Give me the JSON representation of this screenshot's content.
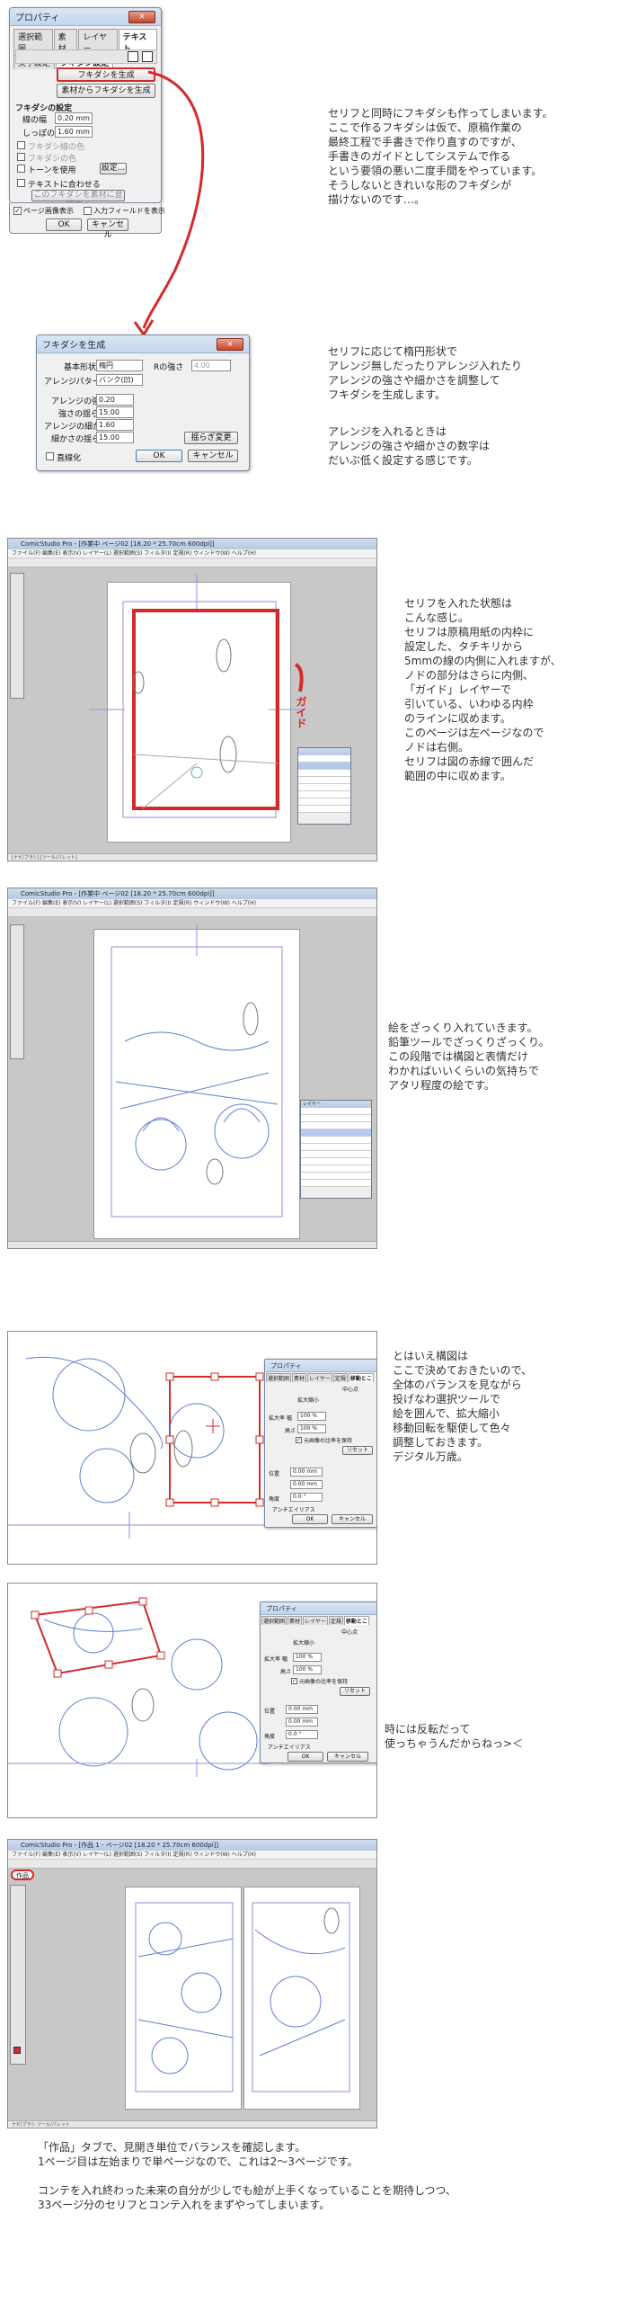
{
  "dialog1": {
    "title": "プロパティ",
    "close": "×",
    "tabs_row1": [
      "選択範囲",
      "素材",
      "レイヤー",
      "テキスト"
    ],
    "tabs_row2": [
      "文字設定",
      "フキダシ設定"
    ],
    "btn_generate": "フキダシを生成",
    "btn_generate_from_material": "素材からフキダシを生成",
    "section_settings": "フキダシの設定",
    "line_width_label": "線の幅",
    "line_width_value": "0.20 mm",
    "tail_width_label": "しっぽの幅",
    "tail_width_value": "1.60 mm",
    "line_color_label": "フキダシ線の色",
    "fill_color_label": "フキダシの色",
    "tone_label": "トーンを使用",
    "settings_button": "設定...",
    "fit_text_label": "テキストに合わせる",
    "register_button": "このフキダシを素材に登録する",
    "show_page_label": "ページ画像表示",
    "show_input_field_label": "入力フィールドを表示",
    "ok": "OK",
    "cancel": "キャンセル"
  },
  "dialog2": {
    "title": "フキダシを生成",
    "close": "×",
    "basic_shape_label": "基本形状",
    "basic_shape_value": "楕円",
    "r_strength_label": "Rの強さ",
    "r_strength_value": "4.00",
    "arrange_pattern_label": "アレンジパターン",
    "arrange_pattern_value": "バンク(凹)",
    "arrange_strength_label": "アレンジの強さ",
    "arrange_strength_value": "0.20",
    "shrink_label": "強さの揺らぎ",
    "shrink_value": "15.00",
    "arrange_fine_label": "アレンジの細かさ",
    "arrange_fine_value": "1.60",
    "fine_shrink_label": "細かさの揺らぎ",
    "fine_shrink_value": "15.00",
    "change_shake_button": "揺らぎ変更",
    "straight_label": "直線化",
    "ok": "OK",
    "cancel": "キャンセル"
  },
  "captions": {
    "c1": "セリフと同時にフキダシも作ってしまいます。\nここで作るフキダシは仮で、原稿作業の\n最終工程で手書きで作り直すのですが、\n手書きのガイドとしてシステムで作る\nという要領の悪い二度手間をやっています。\nそうしないときれいな形のフキダシが\n描けないのです…。",
    "c2": "セリフに応じて楕円形状で\nアレンジ無しだったりアレンジ入れたり\nアレンジの強さや細かさを調整して\nフキダシを生成します。",
    "c3": "アレンジを入れるときは\nアレンジの強さや細かさの数字は\nだいぶ低く設定する感じです。",
    "c4": "セリフを入れた状態は\nこんな感じ。\nセリフは原稿用紙の内枠に\n設定した、タチキリから\n5mmの線の内側に入れますが、\nノドの部分はさらに内側、\n「ガイド」レイヤーで\n引いている、いわゆる内枠\nのラインに収めます。\nこのページは左ページなので\nノドは右側。\nセリフは図の赤線で囲んだ\n範囲の中に収めます。",
    "c5": "絵をざっくり入れていきます。\n鉛筆ツールでざっくりざっくり。\nこの段階では構図と表情だけ\nわかればいいくらいの気持ちで\nアタリ程度の絵です。",
    "c6": "とはいえ構図は\nここで決めておきたいので、\n全体のバランスを見ながら\n投げなわ選択ツールで\n絵を囲んで、拡大縮小\n移動回転を駆使して色々\n調整しておきます。\nデジタル万歳。",
    "c7": "時には反転だって\n使っちゃうんだからねっ>＜",
    "c8": "「作品」タブで、見開き単位でバランスを確認します。\n1ページ目は左始まりで単ページなので、これは2〜3ページです。\n\nコンテを入れ終わった未来の自分が少しでも絵が上手くなっていることを期待しつつ、\n33ページ分のセリフとコンテ入れをまずやってしまいます。"
  },
  "shot1": {
    "title": "ComicStudio Pro - [作業中 ページ02 [18.20 * 25.70cm 600dpi]]",
    "menu": "ファイル(F)  編集(E)  表示(V)  レイヤー(L)  選択範囲(S)  フィルタ(I)  定規(R)  ウィンドウ(W)  ヘルプ(H)",
    "handwritten_mark": "ガイド",
    "status": "[ナビ/ブラシ]  [ツール/パレット]"
  },
  "shot2": {
    "title": "ComicStudio Pro - [作業中 ページ02 [18.20 * 25.70cm 600dpi]]",
    "menu": "ファイル(F)  編集(E)  表示(V)  レイヤー(L)  選択範囲(S)  フィルタ(I)  定規(R)  ウィンドウ(W)  ヘルプ(H)",
    "layer_title": "レイヤー",
    "status": ""
  },
  "shot3": {
    "panel_title": "プロパティ",
    "tabs": [
      "選択範囲",
      "素材",
      "レイヤー",
      "定規",
      "移動とこ"
    ],
    "mode_label": "中心点",
    "transform_label": "拡大縮小",
    "scale_h_label": "拡大率 幅",
    "scale_h_value": "100 %",
    "scale_v_label": "高さ",
    "scale_v_value": "100 %",
    "keep_ratio_label": "元画像の比率を保持",
    "reset_button": "リセット",
    "pos_label": "位置",
    "pos_x_value": "0.00 mm",
    "pos_y_value": "0.00 mm",
    "angle_label": "角度",
    "angle_value": "0.0 °",
    "antialias_label": "アンチエイリアス",
    "ok": "OK",
    "cancel": "キャンセル"
  },
  "shot4": {
    "panel_title": "プロパティ",
    "tabs": [
      "選択範囲",
      "素材",
      "レイヤー",
      "定規",
      "移動とこ"
    ],
    "mode_label": "中心点",
    "transform_label": "拡大縮小",
    "scale_h_label": "拡大率 幅",
    "scale_h_value": "100 %",
    "scale_v_label": "高さ",
    "scale_v_value": "100 %",
    "keep_ratio_label": "元画像の比率を保持",
    "reset_button": "リセット",
    "pos_label": "位置",
    "pos_x_value": "0.00 mm",
    "pos_y_value": "0.00 mm",
    "angle_label": "角度",
    "angle_value": "0.0 °",
    "antialias_label": "アンチエイリアス",
    "ok": "OK",
    "cancel": "キャンセル"
  },
  "shot5": {
    "title": "ComicStudio Pro - [作品 1 - ページ02 [18.20 * 25.70cm 600dpi]]",
    "menu": "ファイル(F)  編集(E)  表示(V)  レイヤー(L)  選択範囲(S)  フィルタ(I)  定規(R)  ウィンドウ(W)  ヘルプ(H)",
    "works_tab": "作品",
    "status": "ナビ/ブラシ  ツール/パレット"
  },
  "colors": {
    "red_annotation": "#d42a2a",
    "pencil_blue": "#5b7fd6",
    "guide_purple": "#6a5acd"
  }
}
